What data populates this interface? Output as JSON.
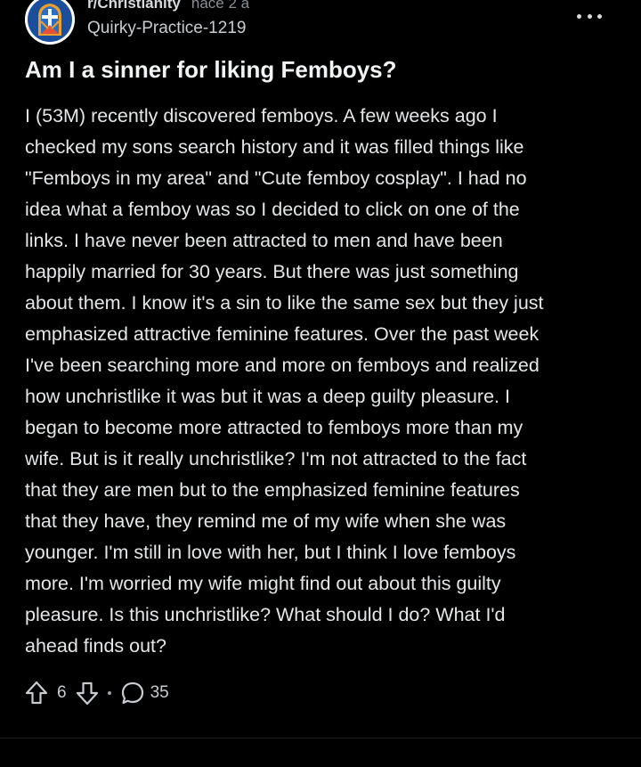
{
  "post": {
    "subreddit": "r/Christianity",
    "age": "hace 2 a",
    "author": "Quirky-Practice-1219",
    "title": "Am I a sinner for liking Femboys?",
    "body": "I (53M) recently discovered femboys. A few weeks ago I\nchecked my sons search history and it was filled things like\n\"Femboys in my area\" and \"Cute femboy cosplay\". I had no\nidea what a femboy was so I decided to click on one of the\nlinks. I have never been attracted to men and have been\nhappily married for 30 years. But there was just something\nabout them. I know it's a sin to like the same sex but they just\nemphasized attractive feminine features. Over the past week\nI've been searching more and more on femboys and realized\nhow unchristlike it was but it was a deep guilty pleasure. I\nbegan to become more attracted to femboys more than my\nwife. But is it really unchristlike? I'm not attracted to the fact\nthat they are men but to the emphasized feminine features\nthat they have, they remind me of my wife when she was\nyounger. I'm still in love with her, but I think I love femboys\nmore. I'm worried my wife might find out about this guilty\npleasure. Is this unchristlike? What should I do? What I'd\nahead finds out?",
    "votes": "6",
    "comments": "35"
  },
  "icons": {
    "subreddit_avatar": "church-window-cross-icon",
    "more": "more-horizontal-icon",
    "upvote": "upvote-arrow-icon",
    "downvote": "downvote-arrow-icon",
    "comments": "comment-bubble-icon"
  },
  "colors": {
    "background": "#000000",
    "text_primary": "#e4e6e8",
    "text_secondary": "#8b8f94",
    "avatar_blue": "#1b4e9b",
    "avatar_orange": "#f0a02a"
  }
}
